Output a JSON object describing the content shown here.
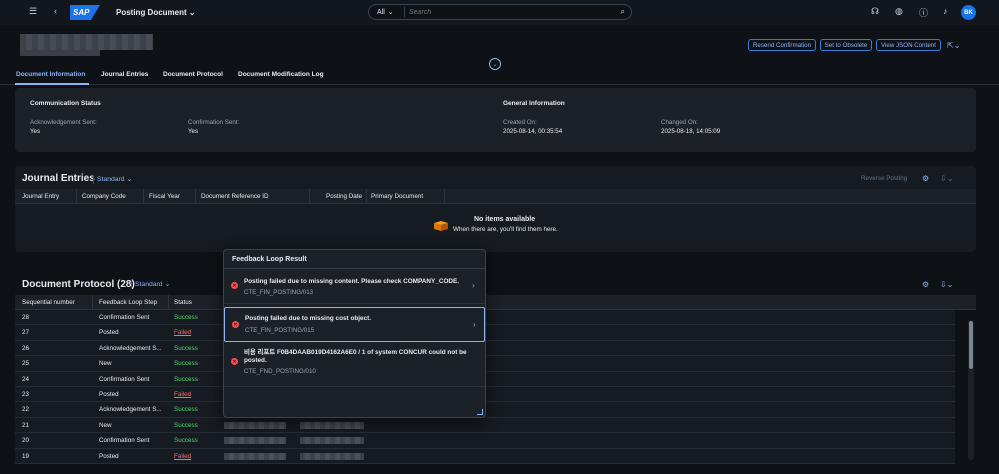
{
  "shell": {
    "logo": "SAP",
    "app_title": "Posting Document",
    "search_scope": "All",
    "search_placeholder": "Search",
    "avatar_initials": "BK"
  },
  "header": {
    "buttons": [
      "Resend Confirmation",
      "Set to Obsolete",
      "View JSON Content"
    ]
  },
  "tabs": [
    "Document Information",
    "Journal Entries",
    "Document Protocol",
    "Document Modification Log"
  ],
  "communication_status": {
    "title": "Communication Status",
    "ack_label": "Acknowledgement Sent:",
    "ack_value": "Yes",
    "conf_label": "Confirmation Sent:",
    "conf_value": "Yes"
  },
  "general_info": {
    "title": "General Information",
    "created_label": "Created On:",
    "created_value": "2025-08-14, 00:35:54",
    "changed_label": "Changed On:",
    "changed_value": "2025-08-18, 14:05:09"
  },
  "journal_entries": {
    "title": "Journal Entries",
    "variant": "Standard",
    "reverse_posting": "Reverse Posting",
    "columns": [
      "Journal Entry",
      "Company Code",
      "Fiscal Year",
      "Document Reference ID",
      "Posting Date",
      "Primary Document"
    ],
    "empty_title": "No items available",
    "empty_text": "When there are, you'll find them here."
  },
  "document_protocol": {
    "title": "Document Protocol (28)",
    "variant": "Standard",
    "columns": [
      "Sequential number",
      "Feedback Loop Step",
      "Status"
    ],
    "rows": [
      {
        "seq": "28",
        "step": "Confirmation Sent",
        "status": "Success"
      },
      {
        "seq": "27",
        "step": "Posted",
        "status": "Failed"
      },
      {
        "seq": "26",
        "step": "Acknowledgement S...",
        "status": "Success"
      },
      {
        "seq": "25",
        "step": "New",
        "status": "Success"
      },
      {
        "seq": "24",
        "step": "Confirmation Sent",
        "status": "Success"
      },
      {
        "seq": "23",
        "step": "Posted",
        "status": "Failed"
      },
      {
        "seq": "22",
        "step": "Acknowledgement S...",
        "status": "Success"
      },
      {
        "seq": "21",
        "step": "New",
        "status": "Success"
      },
      {
        "seq": "20",
        "step": "Confirmation Sent",
        "status": "Success"
      },
      {
        "seq": "19",
        "step": "Posted",
        "status": "Failed"
      }
    ]
  },
  "popover": {
    "title": "Feedback Loop Result",
    "messages": [
      {
        "text": "Posting failed due to missing content. Please check COMPANY_CODE.",
        "code": "CTE_FIN_POSTING/013"
      },
      {
        "text": "Posting failed due to missing cost object.",
        "code": "CTE_FIN_POSTING/015"
      },
      {
        "text": "비용 리포트 F0B4DAAB019D4162A6E0 / 1 of system CONCUR could not be posted.",
        "code": "CTE_FND_POSTING/010"
      }
    ]
  },
  "colors": {
    "accent": "#8ab4f8",
    "success": "#4cd964",
    "error": "#ff6b6b"
  }
}
